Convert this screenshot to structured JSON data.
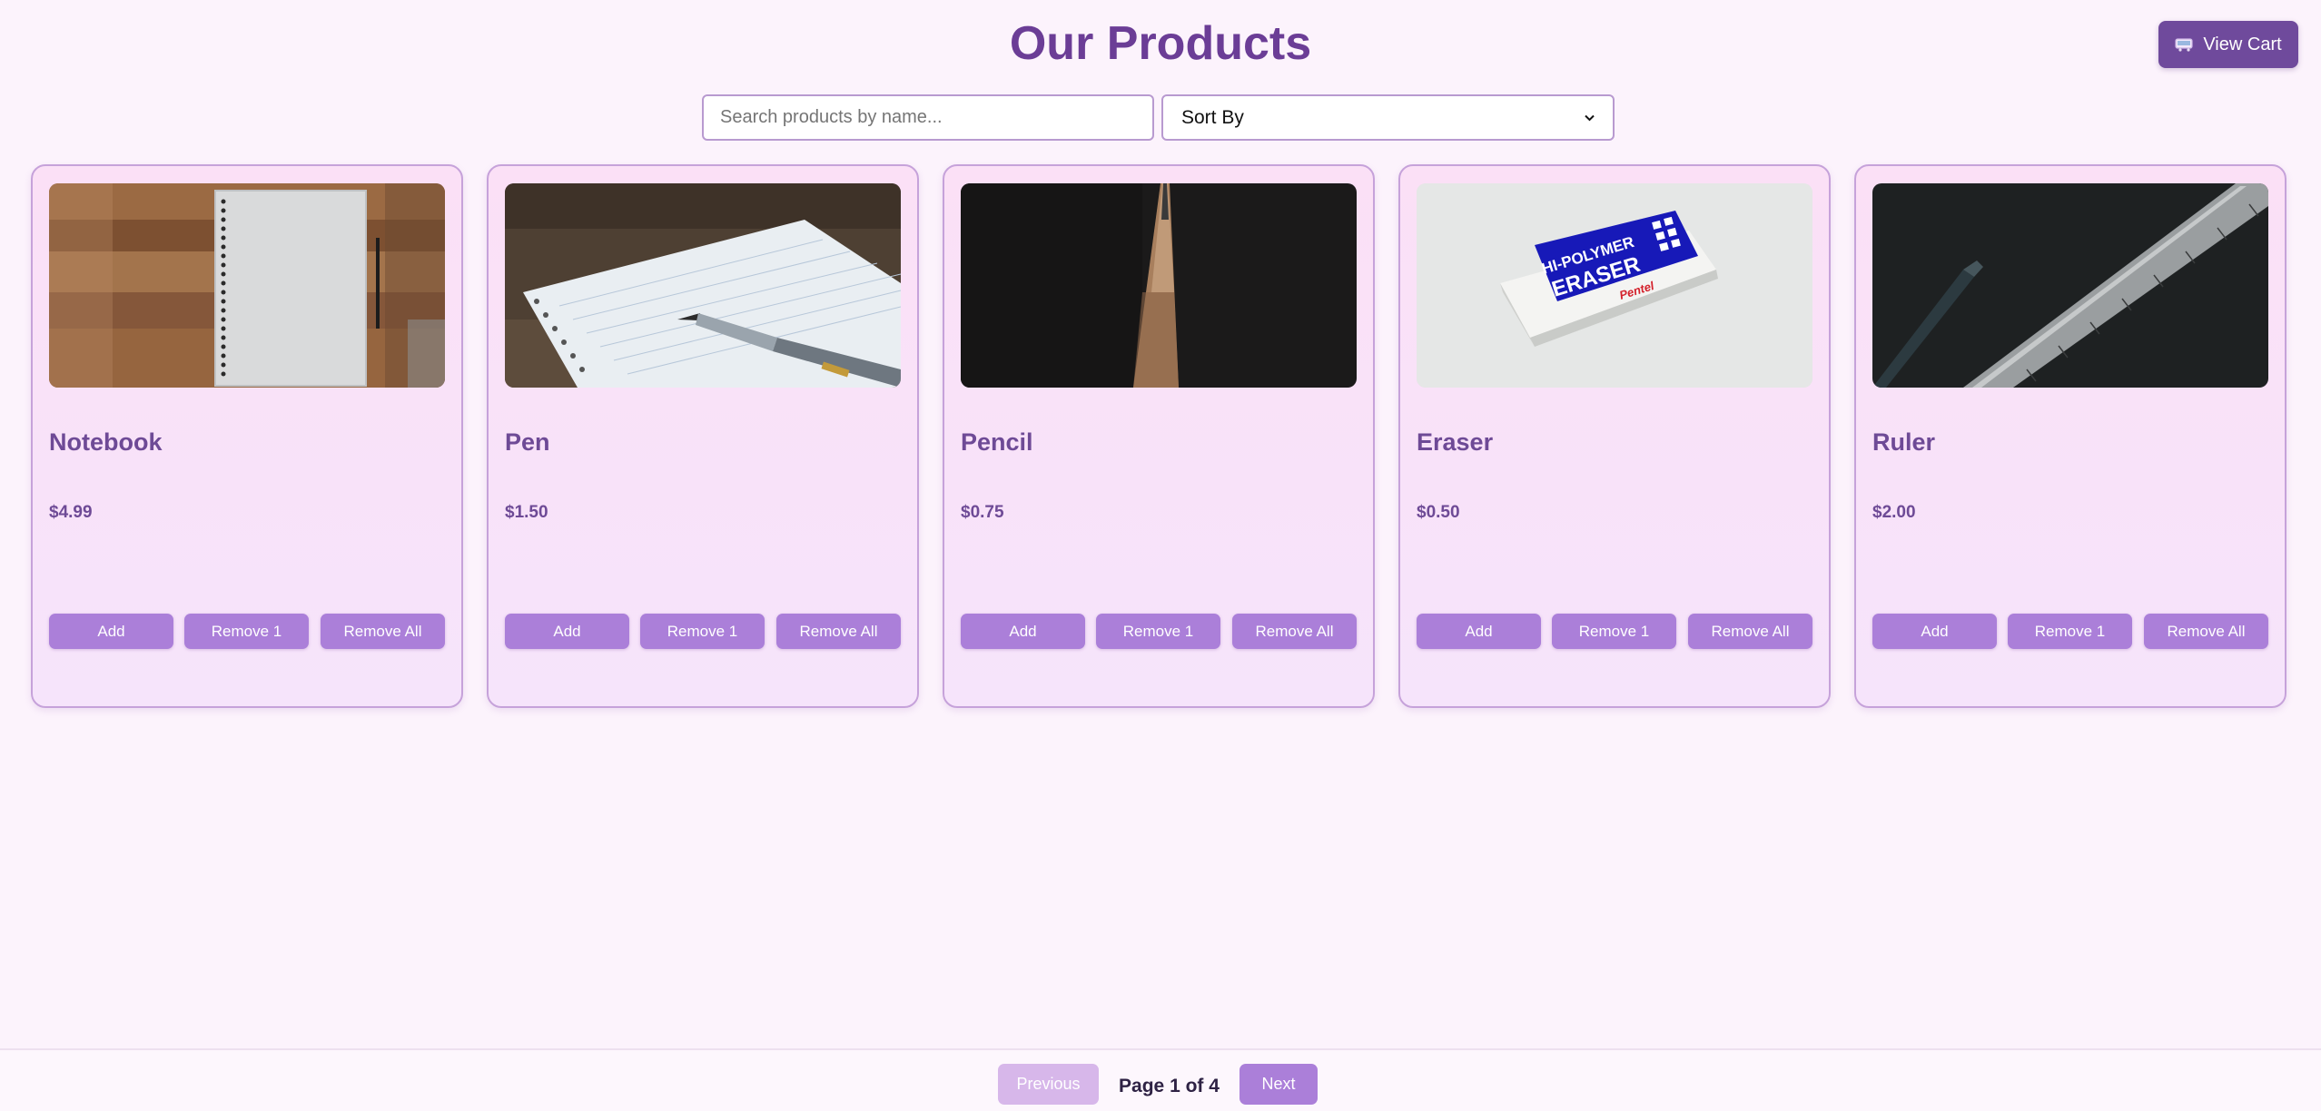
{
  "header": {
    "title": "Our Products",
    "view_cart_label": "View Cart",
    "cart_icon": "cart-icon"
  },
  "search": {
    "placeholder": "Search products by name...",
    "value": ""
  },
  "sort": {
    "selected": "Sort By",
    "icon": "chevron-down-icon"
  },
  "product_buttons": {
    "add": "Add",
    "remove_one": "Remove 1",
    "remove_all": "Remove All"
  },
  "products": [
    {
      "name": "Notebook",
      "price": "$4.99",
      "image": "notebook-image"
    },
    {
      "name": "Pen",
      "price": "$1.50",
      "image": "pen-image"
    },
    {
      "name": "Pencil",
      "price": "$0.75",
      "image": "pencil-image"
    },
    {
      "name": "Eraser",
      "price": "$0.50",
      "image": "eraser-image"
    },
    {
      "name": "Ruler",
      "price": "$2.00",
      "image": "ruler-image"
    }
  ],
  "images": {
    "eraser_text_1": "HI-POLYMER",
    "eraser_text_2": "ERASER",
    "eraser_brand": "Pentel"
  },
  "pagination": {
    "previous_label": "Previous",
    "page_text": "Page 1 of 4",
    "next_label": "Next"
  },
  "colors": {
    "accent": "#6b3d96",
    "button": "#ab7fd9",
    "button_disabled": "#d7b7ea",
    "background": "#fcf3fc"
  }
}
